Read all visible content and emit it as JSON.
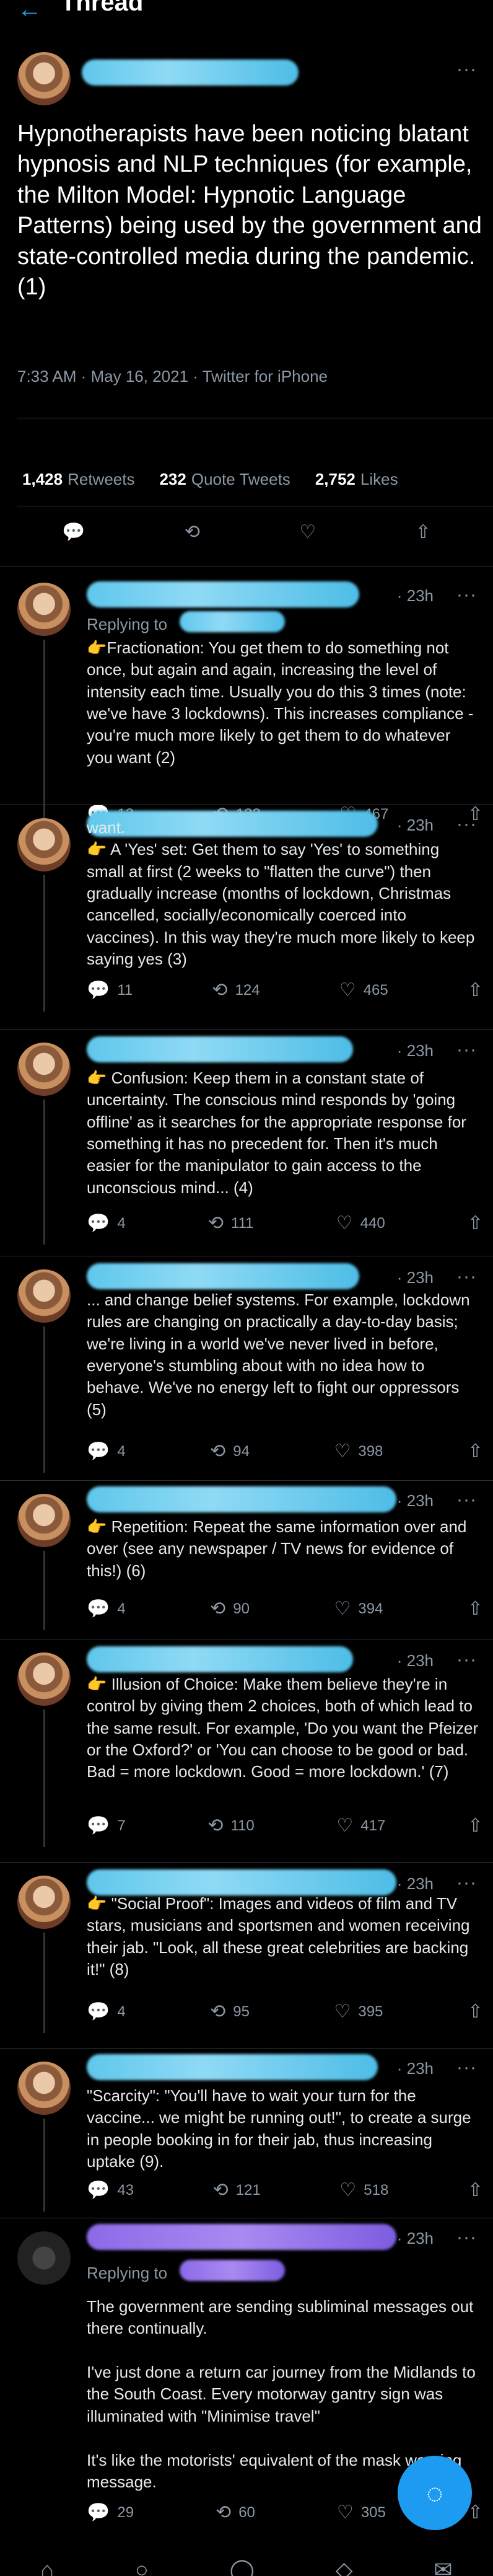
{
  "header": {
    "title": "Thread",
    "back_icon": "arrow-left-icon"
  },
  "main_tweet": {
    "text": "Hypnotherapists have been noticing blatant hypnosis and NLP techniques (for example, the Milton Model: Hypnotic Language Patterns) being used by the government and state-controlled media during the pandemic. (1)",
    "meta": "7:33 AM · May 16, 2021 · Twitter for iPhone",
    "retweets_count": "1,428",
    "retweets_label": "Retweets",
    "quotes_count": "232",
    "quotes_label": "Quote Tweets",
    "likes_count": "2,752",
    "likes_label": "Likes",
    "more": "···"
  },
  "replies": [
    {
      "time": "23h",
      "replying": "Replying to",
      "text": "👉Fractionation: You get them to do something not once, but again and again, increasing the level of intensity each time. Usually you do this 3 times (note: we've have 3 lockdowns). This increases compliance - you're much more likely to get them to do whatever you want (2)",
      "replies": "13",
      "retweets": "132",
      "likes": "467"
    },
    {
      "time": "23h",
      "replying": "",
      "text": "want.\n👉 A 'Yes' set: Get them to say 'Yes' to something small at first (2 weeks to \"flatten the curve\") then gradually increase (months of lockdown, Christmas cancelled, socially/economically coerced into vaccines). In this way they're much more likely to keep saying yes (3)",
      "replies": "11",
      "retweets": "124",
      "likes": "465"
    },
    {
      "time": "23h",
      "replying": "",
      "text": "👉 Confusion: Keep them in a constant state of uncertainty. The conscious mind responds by 'going offline' as it searches for the appropriate response for something it has no precedent for. Then it's much easier for the manipulator to gain access to the unconscious mind... (4)",
      "replies": "4",
      "retweets": "111",
      "likes": "440"
    },
    {
      "time": "23h",
      "replying": "",
      "text": "... and change belief systems. For example, lockdown rules are changing on practically a day-to-day basis; we're living in a world we've never lived in before, everyone's stumbling about with no idea how to behave. We've no energy left to fight our oppressors (5)",
      "replies": "4",
      "retweets": "94",
      "likes": "398"
    },
    {
      "time": "23h",
      "replying": "",
      "text": "👉 Repetition: Repeat the same information over and over (see any newspaper / TV news for evidence of this!) (6)",
      "replies": "4",
      "retweets": "90",
      "likes": "394"
    },
    {
      "time": "23h",
      "replying": "",
      "text": "👉 Illusion of Choice: Make them believe they're in control by giving them 2 choices, both of which lead to the same result. For example, 'Do you want the Pfeizer or the Oxford?' or 'You can choose to be good or bad. Bad = more lockdown. Good = more lockdown.' (7)",
      "replies": "7",
      "retweets": "110",
      "likes": "417"
    },
    {
      "time": "23h",
      "replying": "",
      "text": "👉 \"Social Proof\": Images and videos of film and TV stars, musicians and sportsmen and women receiving their jab. \"Look, all these great celebrities are backing it!\" (8)",
      "replies": "4",
      "retweets": "95",
      "likes": "395"
    },
    {
      "time": "23h",
      "replying": "",
      "text": "\"Scarcity\": \"You'll have to wait your turn for the vaccine... we might be running out!\", to create a surge in people booking in for their jab, thus increasing uptake (9).",
      "replies": "43",
      "retweets": "121",
      "likes": "518"
    },
    {
      "time": "23h",
      "replying": "Replying to",
      "text": "The government are sending subliminal messages out there continually.\n\nI've just done a return car journey from the Midlands to the South Coast. Every motorway gantry sign was illuminated with \"Minimise travel\"\n\nIt's like the motorists' equivalent of the mask wearing message.",
      "replies": "29",
      "retweets": "60",
      "likes": "305"
    }
  ],
  "icons": {
    "reply": "💬",
    "retweet": "⟲",
    "like": "♡",
    "share": "⇧"
  },
  "colors": {
    "accent": "#1d9bf0",
    "background": "#000000",
    "muted": "#8b98a5"
  }
}
